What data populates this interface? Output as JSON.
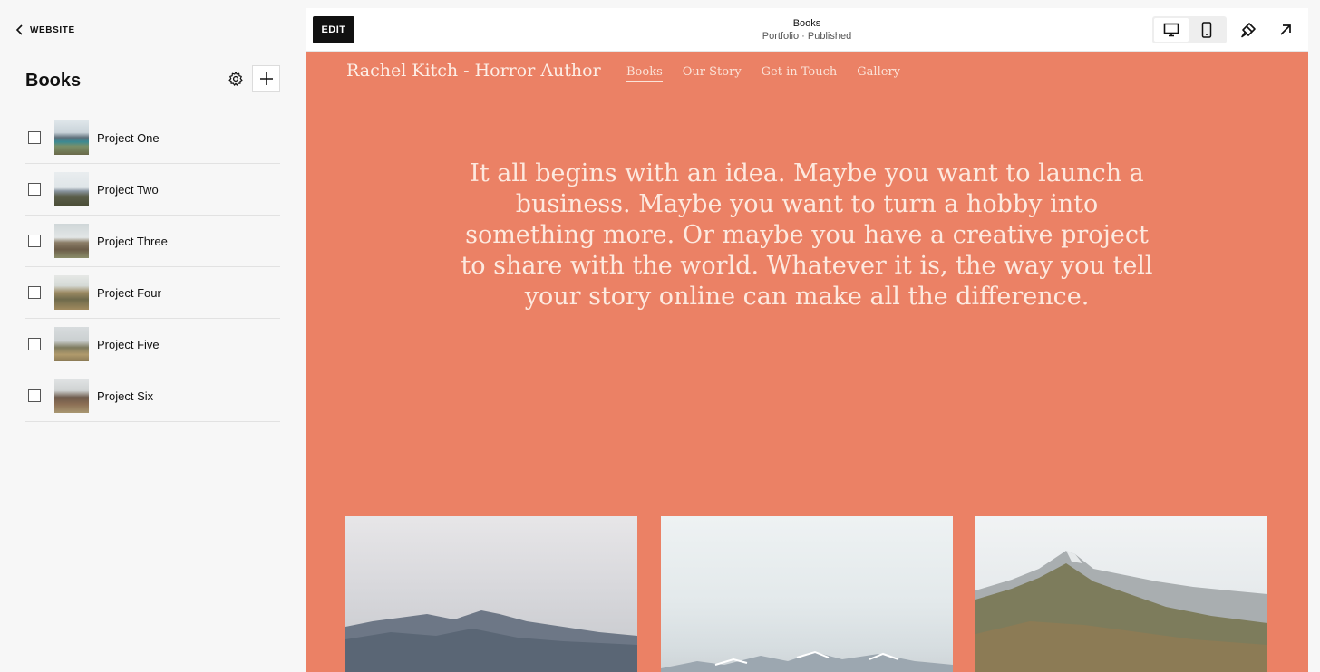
{
  "sidebar": {
    "back_label": "WEBSITE",
    "title": "Books",
    "projects": [
      {
        "label": "Project One"
      },
      {
        "label": "Project Two"
      },
      {
        "label": "Project Three"
      },
      {
        "label": "Project Four"
      },
      {
        "label": "Project Five"
      },
      {
        "label": "Project Six"
      }
    ]
  },
  "topbar": {
    "edit_label": "EDIT",
    "page_title": "Books",
    "page_subtitle": "Portfolio · Published"
  },
  "site": {
    "title": "Rachel Kitch - Horror Author",
    "nav": [
      "Books",
      "Our Story",
      "Get in Touch",
      "Gallery"
    ],
    "active_nav": "Books",
    "hero": "It all begins with an idea. Maybe you want to launch a business. Maybe you want to turn a hobby into something more. Or maybe you have a creative project to share with the world. Whatever it is, the way you tell your story online can make all the difference.",
    "background_color": "#eb8165"
  },
  "icons": {
    "back": "chevron-left-icon",
    "settings": "gear-icon",
    "add": "plus-icon",
    "desktop": "desktop-icon",
    "mobile": "mobile-icon",
    "style": "paintbrush-icon",
    "open": "arrow-up-right-icon"
  }
}
